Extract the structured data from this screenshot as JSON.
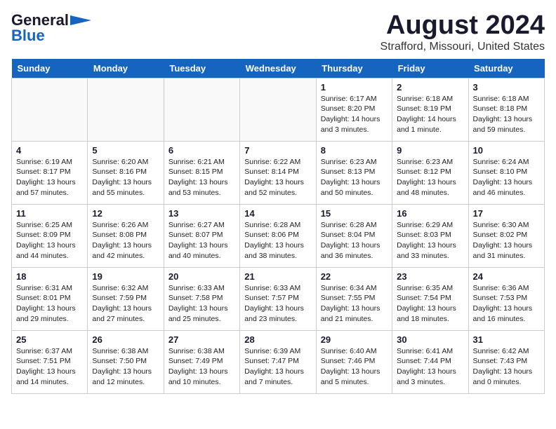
{
  "logo": {
    "general": "General",
    "blue": "Blue"
  },
  "header": {
    "month_year": "August 2024",
    "location": "Strafford, Missouri, United States"
  },
  "weekdays": [
    "Sunday",
    "Monday",
    "Tuesday",
    "Wednesday",
    "Thursday",
    "Friday",
    "Saturday"
  ],
  "weeks": [
    [
      {
        "day": "",
        "data": ""
      },
      {
        "day": "",
        "data": ""
      },
      {
        "day": "",
        "data": ""
      },
      {
        "day": "",
        "data": ""
      },
      {
        "day": "1",
        "data": "Sunrise: 6:17 AM\nSunset: 8:20 PM\nDaylight: 14 hours\nand 3 minutes."
      },
      {
        "day": "2",
        "data": "Sunrise: 6:18 AM\nSunset: 8:19 PM\nDaylight: 14 hours\nand 1 minute."
      },
      {
        "day": "3",
        "data": "Sunrise: 6:18 AM\nSunset: 8:18 PM\nDaylight: 13 hours\nand 59 minutes."
      }
    ],
    [
      {
        "day": "4",
        "data": "Sunrise: 6:19 AM\nSunset: 8:17 PM\nDaylight: 13 hours\nand 57 minutes."
      },
      {
        "day": "5",
        "data": "Sunrise: 6:20 AM\nSunset: 8:16 PM\nDaylight: 13 hours\nand 55 minutes."
      },
      {
        "day": "6",
        "data": "Sunrise: 6:21 AM\nSunset: 8:15 PM\nDaylight: 13 hours\nand 53 minutes."
      },
      {
        "day": "7",
        "data": "Sunrise: 6:22 AM\nSunset: 8:14 PM\nDaylight: 13 hours\nand 52 minutes."
      },
      {
        "day": "8",
        "data": "Sunrise: 6:23 AM\nSunset: 8:13 PM\nDaylight: 13 hours\nand 50 minutes."
      },
      {
        "day": "9",
        "data": "Sunrise: 6:23 AM\nSunset: 8:12 PM\nDaylight: 13 hours\nand 48 minutes."
      },
      {
        "day": "10",
        "data": "Sunrise: 6:24 AM\nSunset: 8:10 PM\nDaylight: 13 hours\nand 46 minutes."
      }
    ],
    [
      {
        "day": "11",
        "data": "Sunrise: 6:25 AM\nSunset: 8:09 PM\nDaylight: 13 hours\nand 44 minutes."
      },
      {
        "day": "12",
        "data": "Sunrise: 6:26 AM\nSunset: 8:08 PM\nDaylight: 13 hours\nand 42 minutes."
      },
      {
        "day": "13",
        "data": "Sunrise: 6:27 AM\nSunset: 8:07 PM\nDaylight: 13 hours\nand 40 minutes."
      },
      {
        "day": "14",
        "data": "Sunrise: 6:28 AM\nSunset: 8:06 PM\nDaylight: 13 hours\nand 38 minutes."
      },
      {
        "day": "15",
        "data": "Sunrise: 6:28 AM\nSunset: 8:04 PM\nDaylight: 13 hours\nand 36 minutes."
      },
      {
        "day": "16",
        "data": "Sunrise: 6:29 AM\nSunset: 8:03 PM\nDaylight: 13 hours\nand 33 minutes."
      },
      {
        "day": "17",
        "data": "Sunrise: 6:30 AM\nSunset: 8:02 PM\nDaylight: 13 hours\nand 31 minutes."
      }
    ],
    [
      {
        "day": "18",
        "data": "Sunrise: 6:31 AM\nSunset: 8:01 PM\nDaylight: 13 hours\nand 29 minutes."
      },
      {
        "day": "19",
        "data": "Sunrise: 6:32 AM\nSunset: 7:59 PM\nDaylight: 13 hours\nand 27 minutes."
      },
      {
        "day": "20",
        "data": "Sunrise: 6:33 AM\nSunset: 7:58 PM\nDaylight: 13 hours\nand 25 minutes."
      },
      {
        "day": "21",
        "data": "Sunrise: 6:33 AM\nSunset: 7:57 PM\nDaylight: 13 hours\nand 23 minutes."
      },
      {
        "day": "22",
        "data": "Sunrise: 6:34 AM\nSunset: 7:55 PM\nDaylight: 13 hours\nand 21 minutes."
      },
      {
        "day": "23",
        "data": "Sunrise: 6:35 AM\nSunset: 7:54 PM\nDaylight: 13 hours\nand 18 minutes."
      },
      {
        "day": "24",
        "data": "Sunrise: 6:36 AM\nSunset: 7:53 PM\nDaylight: 13 hours\nand 16 minutes."
      }
    ],
    [
      {
        "day": "25",
        "data": "Sunrise: 6:37 AM\nSunset: 7:51 PM\nDaylight: 13 hours\nand 14 minutes."
      },
      {
        "day": "26",
        "data": "Sunrise: 6:38 AM\nSunset: 7:50 PM\nDaylight: 13 hours\nand 12 minutes."
      },
      {
        "day": "27",
        "data": "Sunrise: 6:38 AM\nSunset: 7:49 PM\nDaylight: 13 hours\nand 10 minutes."
      },
      {
        "day": "28",
        "data": "Sunrise: 6:39 AM\nSunset: 7:47 PM\nDaylight: 13 hours\nand 7 minutes."
      },
      {
        "day": "29",
        "data": "Sunrise: 6:40 AM\nSunset: 7:46 PM\nDaylight: 13 hours\nand 5 minutes."
      },
      {
        "day": "30",
        "data": "Sunrise: 6:41 AM\nSunset: 7:44 PM\nDaylight: 13 hours\nand 3 minutes."
      },
      {
        "day": "31",
        "data": "Sunrise: 6:42 AM\nSunset: 7:43 PM\nDaylight: 13 hours\nand 0 minutes."
      }
    ]
  ]
}
